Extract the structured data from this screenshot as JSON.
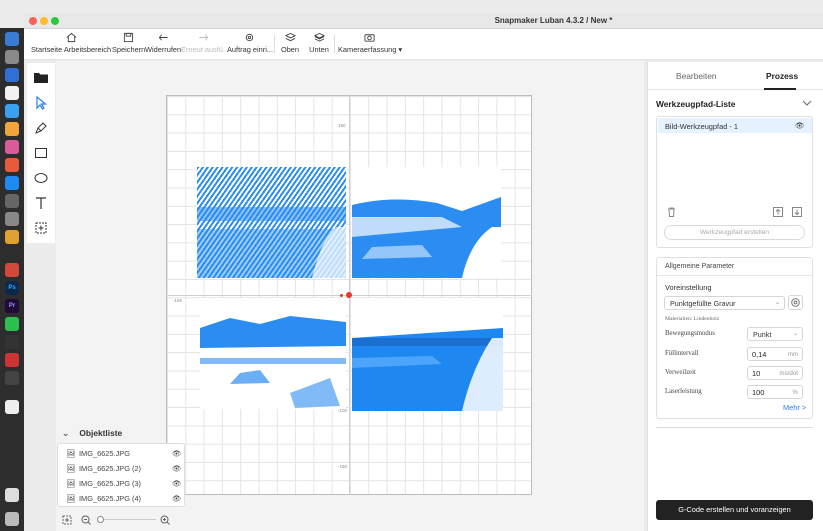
{
  "window": {
    "title": "Snapmaker Luban 4.3.2 / New *"
  },
  "toolbar": {
    "home": "Startseite Arbeitsbereich",
    "save": "Speichern",
    "undo": "Widerrufen",
    "redo": "Erneut ausfü...",
    "job": "Auftrag einri...",
    "top": "Oben",
    "bottom": "Unten",
    "camera": "Kameraerfassung"
  },
  "canvas": {
    "ticks": {
      "top": "150",
      "bottom_mid": "-100",
      "bottom": "-150",
      "left": "-150"
    }
  },
  "object_list": {
    "title": "Objektliste",
    "items": [
      "IMG_6625.JPG",
      "IMG_6625.JPG (2)",
      "IMG_6625.JPG (3)",
      "IMG_6625.JPG (4)"
    ]
  },
  "panel": {
    "tabs": {
      "edit": "Bearbeiten",
      "process": "Prozess"
    },
    "toolpath_title": "Werkzeugpfad-Liste",
    "toolpath_item": "Bild-Werkzeugpfad - 1",
    "create_toolpath": "Werkzeugpfad erstellen",
    "params_title": "Allgemeine Parameter",
    "preset_label": "Voreinstellung",
    "preset_value": "Punktgefüllte Gravur",
    "material": "Materialien: Lindenholz",
    "motion_label": "Bewegungsmodus",
    "motion_value": "Punkt",
    "fill_label": "Füllintervall",
    "fill_value": "0,14",
    "fill_unit": "mm",
    "dwell_label": "Verweilzeit",
    "dwell_value": "10",
    "dwell_unit": "ms/dot",
    "power_label": "Laserleistung",
    "power_value": "100",
    "power_unit": "%",
    "more": "Mehr >",
    "gcode": "G-Code erstellen und voranzeigen"
  },
  "colors": {
    "accent": "#2b8df2",
    "origin": "#e8382c",
    "dark_button": "#222222"
  }
}
